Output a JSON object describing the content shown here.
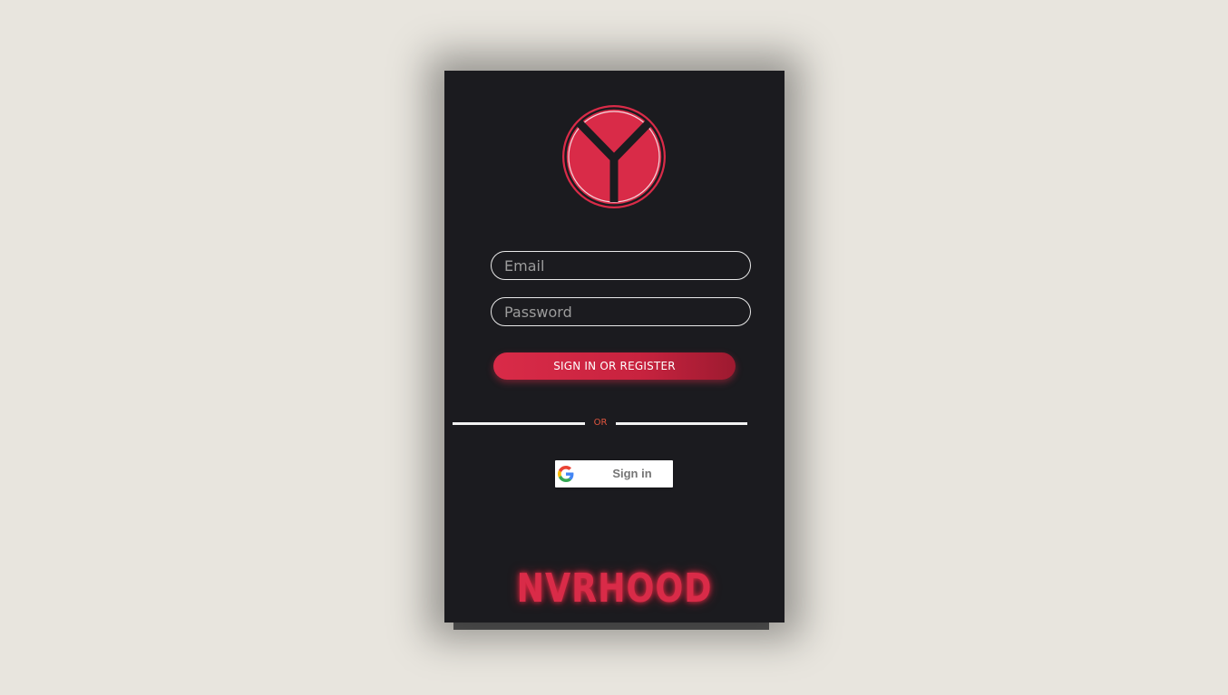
{
  "login": {
    "logo_icon": "y-circle-logo-icon",
    "email_placeholder": "Email",
    "password_placeholder": "Password",
    "primary_button_label": "SIGN IN OR REGISTER",
    "divider_text": "OR",
    "google_icon": "google-g-icon",
    "google_button_label": "Sign in",
    "brand_name": "NVRHOOD"
  },
  "colors": {
    "page_background": "#e8e5de",
    "card_background": "#1b1b1f",
    "accent": "#d92b48",
    "divider_text": "#e0563f"
  }
}
